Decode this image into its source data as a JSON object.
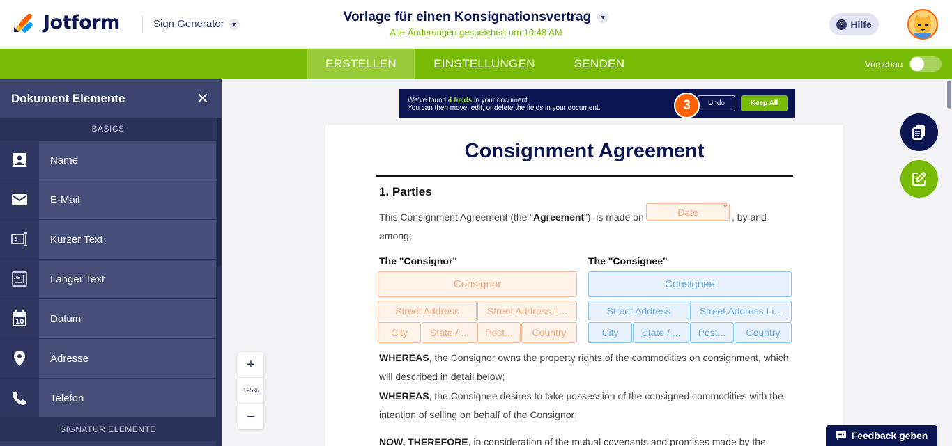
{
  "app": {
    "brand": "Jotform",
    "product": "Sign Generator",
    "document_title": "Vorlage für einen Konsignationsvertrag",
    "save_status": "Alle Änderungen gespeichert um 10:48 AM",
    "help_label": "Hilfe"
  },
  "nav": {
    "tabs": [
      {
        "label": "ERSTELLEN",
        "active": true
      },
      {
        "label": "EINSTELLUNGEN",
        "active": false
      },
      {
        "label": "SENDEN",
        "active": false
      }
    ],
    "preview_label": "Vorschau",
    "preview_on": false
  },
  "sidebar": {
    "title": "Dokument Elemente",
    "section_basics": "BASICS",
    "items": [
      {
        "label": "Name",
        "icon": "person-card-icon"
      },
      {
        "label": "E-Mail",
        "icon": "envelope-icon"
      },
      {
        "label": "Kurzer Text",
        "icon": "short-text-icon"
      },
      {
        "label": "Langer Text",
        "icon": "long-text-icon"
      },
      {
        "label": "Datum",
        "icon": "calendar-icon"
      },
      {
        "label": "Adresse",
        "icon": "map-pin-icon"
      },
      {
        "label": "Telefon",
        "icon": "phone-icon"
      }
    ],
    "section_signature": "SIGNATUR ELEMENTE"
  },
  "banner": {
    "line1_pre": "We've found",
    "line1_highlight": "4 fields",
    "line1_post": "in your document.",
    "line2": "You can then move, edit, or delete the fields in your document.",
    "undo_label": "Undo",
    "keep_label": "Keep All",
    "badge": "3"
  },
  "document": {
    "title": "Consignment Agreement",
    "section1": "1. Parties",
    "intro_pre": "This Consignment Agreement (the “",
    "intro_bold": "Agreement",
    "intro_mid": "”), is made on",
    "intro_post": ", by and",
    "intro_line2": "among;",
    "date_field": "Date",
    "date_required": "*",
    "consignor_heading": "The \"Consignor\"",
    "consignee_heading": "The \"Consignee\"",
    "consignor_fields": {
      "name": "Consignor",
      "street": "Street Address",
      "street2": "Street Address L...",
      "city": "City",
      "state": "State / ...",
      "postal": "Post...",
      "country": "Country"
    },
    "consignee_fields": {
      "name": "Consignee",
      "street": "Street Address",
      "street2": "Street Address Li...",
      "city": "City",
      "state": "State / ...",
      "postal": "Post...",
      "country": "Country"
    },
    "whereas1_bold": "WHEREAS",
    "whereas1_rest": ", the Consignor owns the property rights of the commodities on consignment, which",
    "whereas1_line2": "will described in detail below;",
    "whereas2_bold": "WHEREAS",
    "whereas2_rest": ", the Consignee desires to take possession of the consigned commodities with the",
    "whereas2_line2": "intention of selling on behalf of the Consignor;",
    "now_bold": "NOW, THEREFORE",
    "now_rest": ", in consideration of the mutual covenants and promises made by the"
  },
  "zoom": {
    "in": "+",
    "level": "125%",
    "out": "−"
  },
  "feedback_label": "Feedback geben",
  "colors": {
    "navy": "#0a1551",
    "green": "#78bb07",
    "orange": "#ff6100",
    "sidebar": "#343c6a"
  }
}
